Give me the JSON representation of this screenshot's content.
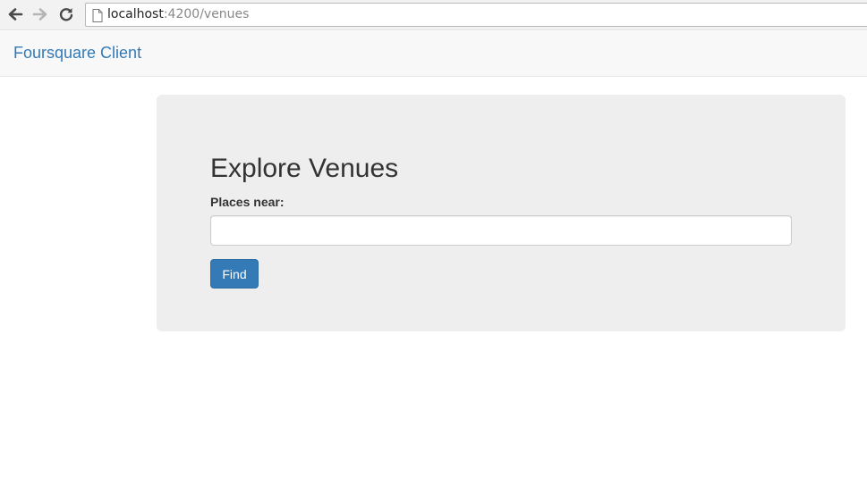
{
  "browser": {
    "url_host": "localhost",
    "url_rest": ":4200/venues",
    "icons": [
      "back-arrow-icon",
      "forward-arrow-icon",
      "reload-icon",
      "page-icon"
    ]
  },
  "navbar": {
    "brand": "Foursquare Client",
    "brand_color": "#337ab7"
  },
  "search": {
    "title": "Explore Venues",
    "label": "Places near:",
    "input_value": "",
    "button_label": "Find",
    "button_color": "#337ab7"
  }
}
